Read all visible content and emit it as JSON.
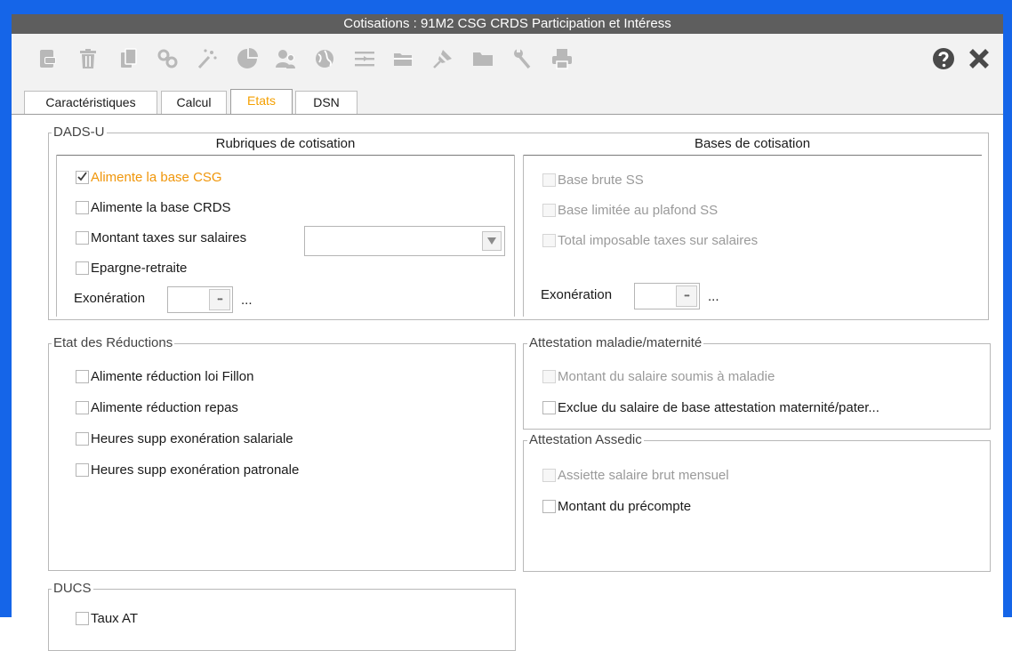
{
  "window": {
    "title": "Cotisations : 91M2 CSG CRDS Participation et Intéress"
  },
  "toolbar": {
    "icons": [
      "export-icon",
      "delete-icon",
      "copy-icon",
      "link-icon",
      "wand-icon",
      "chart-icon",
      "users-icon",
      "globe-icon",
      "filter-icon",
      "folder-open-icon",
      "pin-icon",
      "folder-icon",
      "tools-icon",
      "print-icon"
    ],
    "help_icon": "help-icon",
    "close_icon": "close-icon"
  },
  "tabs": [
    {
      "label": "Caractéristiques",
      "active": false
    },
    {
      "label": "Calcul",
      "active": false
    },
    {
      "label": "Etats",
      "active": true
    },
    {
      "label": "DSN",
      "active": false
    }
  ],
  "dadsu": {
    "title": "DADS-U",
    "rubriques": {
      "header": "Rubriques de cotisation",
      "items": [
        {
          "label": "Alimente la base CSG",
          "checked": true
        },
        {
          "label": "Alimente la base CRDS",
          "checked": false
        },
        {
          "label": "Montant taxes sur salaires",
          "checked": false
        },
        {
          "label": "Epargne-retraite",
          "checked": false
        }
      ],
      "exoneration_label": "Exonération",
      "exoneration_ellipsis": "..."
    },
    "bases": {
      "header": "Bases de cotisation",
      "items": [
        {
          "label": "Base brute SS",
          "checked": false
        },
        {
          "label": "Base limitée au plafond SS",
          "checked": false
        },
        {
          "label": "Total imposable taxes sur salaires",
          "checked": false
        }
      ],
      "exoneration_label": "Exonération",
      "exoneration_ellipsis": "..."
    }
  },
  "reductions": {
    "title": "Etat des Réductions",
    "items": [
      {
        "label": "Alimente réduction loi Fillon"
      },
      {
        "label": "Alimente réduction repas"
      },
      {
        "label": "Heures supp exonération salariale"
      },
      {
        "label": "Heures supp exonération patronale"
      }
    ]
  },
  "maladie": {
    "title": "Attestation maladie/maternité",
    "items": [
      {
        "label": "Montant du salaire soumis à maladie",
        "disabled": true
      },
      {
        "label": "Exclue du salaire de base attestation maternité/pater...",
        "disabled": false
      }
    ]
  },
  "assedic": {
    "title": "Attestation Assedic",
    "items": [
      {
        "label": "Assiette salaire brut mensuel",
        "disabled": true
      },
      {
        "label": "Montant du précompte",
        "disabled": false
      }
    ]
  },
  "ducs": {
    "title": "DUCS",
    "items": [
      {
        "label": "Taux AT"
      }
    ]
  },
  "colors": {
    "frame": "#1565e8",
    "titlebar": "#5e5e5e",
    "accent": "#f5a000",
    "icons": "#b8b8b8"
  }
}
